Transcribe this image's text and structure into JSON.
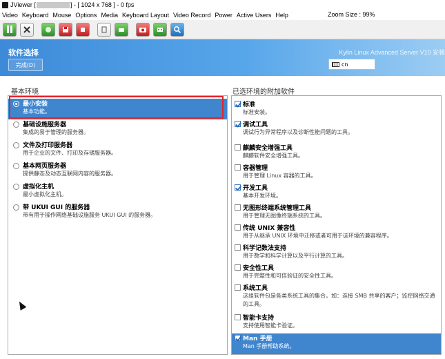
{
  "window": {
    "title_prefix": "JViewer [",
    "title_suffix": "] - [ 1024 x 768 ] - 0 fps"
  },
  "menu": {
    "items": [
      "Video",
      "Keyboard",
      "Mouse",
      "Options",
      "Media",
      "Keyboard Layout",
      "Video Record",
      "Power",
      "Active Users",
      "Help"
    ],
    "zoom": "Zoom Size : 99%"
  },
  "toolbar": {
    "icons": [
      "pause-icon",
      "disconnect-icon",
      "record-icon",
      "save-icon",
      "stop-icon",
      "copy-icon",
      "print-icon",
      "camera-icon",
      "users-icon",
      "zoom-icon"
    ]
  },
  "header": {
    "title": "软件选择",
    "done_label": "完成(D)",
    "product": "Kylin Linux Advanced Server V10 安装",
    "keyboard_layout": "cn"
  },
  "left": {
    "title": "基本环境",
    "items": [
      {
        "name": "最小安装",
        "desc": "基本功能。",
        "selected": true
      },
      {
        "name": "基础设施服务器",
        "desc": "集成的易于管理的服务器。",
        "selected": false
      },
      {
        "name": "文件及打印服务器",
        "desc": "用于企业的文件、打印及存储服务器。",
        "selected": false
      },
      {
        "name": "基本网页服务器",
        "desc": "提供静态及动态互联网内容的服务器。",
        "selected": false
      },
      {
        "name": "虚拟化主机",
        "desc": "最小虚拟化主机。",
        "selected": false
      },
      {
        "name": "带 UKUI GUI 的服务器",
        "desc": "带有用于操作网络基础设施服务 UKUI GUI 的服务器。",
        "selected": false
      }
    ]
  },
  "right": {
    "title": "已选环境的附加软件",
    "items": [
      {
        "name": "标准",
        "desc": "标准安装。",
        "checked": true
      },
      {
        "name": "调试工具",
        "desc": "调试行为异常程序以及诊断性能问题的工具。",
        "checked": true
      },
      {
        "name": "麒麟安全增强工具",
        "desc": "麒麟软件安全增强工具。",
        "checked": false
      },
      {
        "name": "容器管理",
        "desc": "用于管理 Linux 容器的工具。",
        "checked": false
      },
      {
        "name": "开发工具",
        "desc": "基本开发环境。",
        "checked": true
      },
      {
        "name": "无图形终端系统管理工具",
        "desc": "用于管理无图像终端系统的工具。",
        "checked": false
      },
      {
        "name": "传统 UNIX 兼容性",
        "desc": "用于从继承 UNIX 环境中迁移或者可用于该环境的兼容程序。",
        "checked": false
      },
      {
        "name": "科学记数法支持",
        "desc": "用于数学和科学计算以及平行计算的工具。",
        "checked": false
      },
      {
        "name": "安全性工具",
        "desc": "用于完整性和可信验证的安全性工具。",
        "checked": false
      },
      {
        "name": "系统工具",
        "desc": "这组软件包是各类系统工具的集合，如：连接 SMB 共享的客户；监控网络交通",
        "desc2": "的工具。",
        "checked": false
      },
      {
        "name": "智能卡支持",
        "desc": "支持使用智能卡验证。",
        "checked": false
      },
      {
        "name": "Man 手册",
        "desc": "Man 手册帮助系统。",
        "checked": true,
        "selected": true
      }
    ]
  }
}
